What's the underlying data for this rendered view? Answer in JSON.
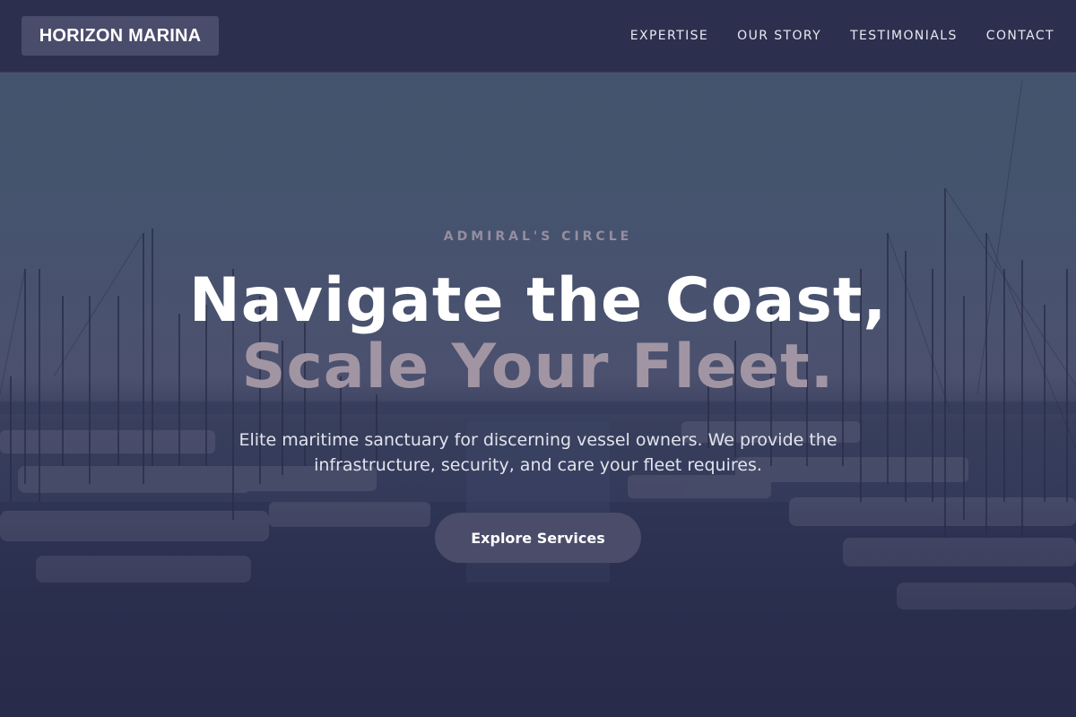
{
  "brand": {
    "name": "HORIZON MARINA"
  },
  "nav": {
    "items": [
      {
        "label": "EXPERTISE"
      },
      {
        "label": "OUR STORY"
      },
      {
        "label": "TESTIMONIALS"
      },
      {
        "label": "CONTACT"
      }
    ]
  },
  "hero": {
    "eyebrow": "ADMIRAL'S CIRCLE",
    "headline_line1": "Navigate the Coast,",
    "headline_line2": "Scale Your Fleet.",
    "subtitle": "Elite maritime sanctuary for discerning vessel owners. We provide the infrastructure, security, and care your fleet requires.",
    "cta_label": "Explore Services",
    "background_image": "marina-masts-photo"
  },
  "colors": {
    "header_bg": "#2d2f4e",
    "logo_bg": "#4a4c6c",
    "accent_muted": "#a295a3",
    "eyebrow": "#958ea0",
    "cta_bg": "#4a4c6a",
    "page_bg": "#272a48"
  }
}
